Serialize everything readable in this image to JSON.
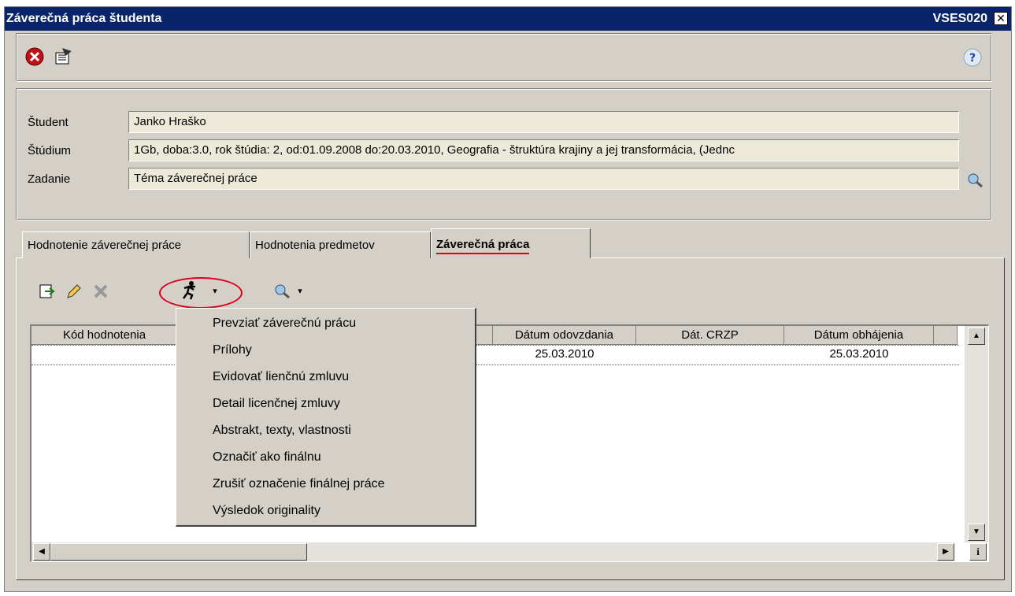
{
  "window": {
    "title": "Záverečná práca študenta",
    "code": "VSES020",
    "close_glyph": "✕"
  },
  "toolbar": {
    "icons": [
      "exit-icon",
      "filter-icon",
      "help-icon"
    ]
  },
  "info": {
    "student_label": "Študent",
    "student_value": "Janko Hraško",
    "studium_label": "Štúdium",
    "studium_value": "1Gb, doba:3.0, rok štúdia: 2, od:01.09.2008 do:20.03.2010, Geografia - štruktúra krajiny a jej transformácia, (Jednc",
    "zadanie_label": "Zadanie",
    "zadanie_value": "Téma záverečnej práce"
  },
  "tabs": [
    {
      "label": "Hodnotenie záverečnej práce"
    },
    {
      "label": "Hodnotenia predmetov"
    },
    {
      "label": "Záverečná práca",
      "active": true
    }
  ],
  "grid": {
    "columns": [
      "Kód hodnotenia",
      "Dátum odovzdania",
      "Dát. CRZP",
      "Dátum obhájenia"
    ],
    "rows": [
      {
        "datum_odovzdania": "25.03.2010",
        "dat_crzp": "",
        "datum_obhajenia": "25.03.2010"
      }
    ]
  },
  "menu": {
    "items": [
      "Prevziať záverečnú prácu",
      "Prílohy",
      "Evidovať lienčnú zmluvu",
      "Detail licenčnej zmluvy",
      "Abstrakt, texty, vlastnosti",
      "Označiť ako finálnu",
      "Zrušiť označenie finálnej práce",
      "Výsledok originality"
    ]
  },
  "colors": {
    "title_bar": "#0a246a",
    "window_bg": "#d4d0c8",
    "highlight": "#d9001b"
  }
}
